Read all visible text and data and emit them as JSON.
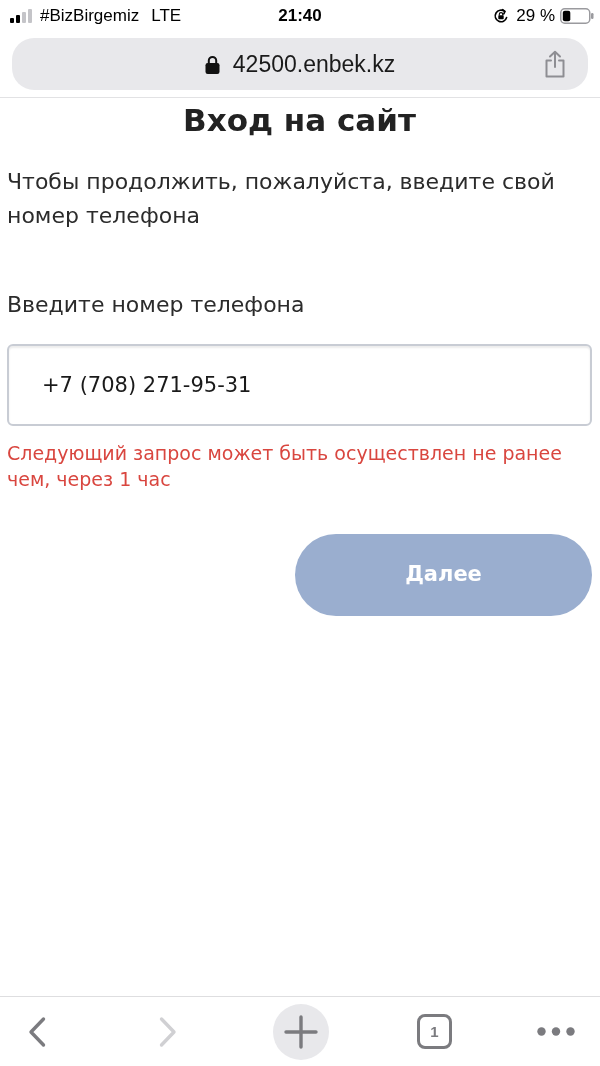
{
  "status_bar": {
    "carrier": "#BizBirgemiz",
    "network": "LTE",
    "time": "21:40",
    "battery": "29 %"
  },
  "address_bar": {
    "url": "42500.enbek.kz"
  },
  "page": {
    "heading": "Вход на сайт",
    "intro": "Чтобы продолжить, пожалуйста, введите свой номер телефона",
    "phone_label": "Введите номер телефона",
    "phone_field": {
      "value": "+7 (708) 271-95-31"
    },
    "error": "Следующий запрос может быть осуществлен не ранее чем, через 1 час",
    "next_button": {
      "label": "Далее",
      "disabled": true
    }
  },
  "toolbar": {
    "back": {
      "disabled": false
    },
    "forward": {
      "disabled": true
    },
    "tab_count": "1"
  }
}
